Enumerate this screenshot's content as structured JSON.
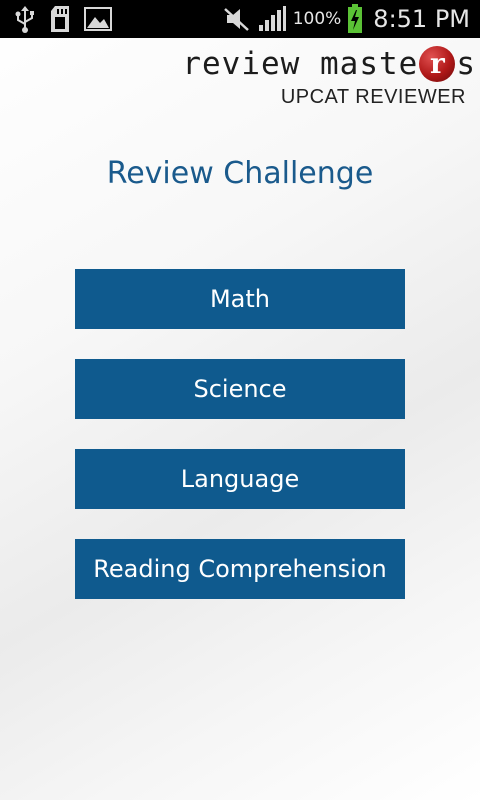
{
  "status_bar": {
    "battery_percent": "100%",
    "time": "8:51 PM",
    "icons": [
      "usb-icon",
      "sd-card-icon",
      "image-icon",
      "mute-icon",
      "signal-icon",
      "battery-charging-icon"
    ]
  },
  "header": {
    "logo_text_left": "review maste",
    "logo_badge": "r",
    "logo_text_right": "s",
    "subtitle": "UPCAT REVIEWER"
  },
  "main": {
    "title": "Review Challenge",
    "buttons": [
      {
        "label": "Math"
      },
      {
        "label": "Science"
      },
      {
        "label": "Language"
      },
      {
        "label": "Reading Comprehension"
      }
    ]
  },
  "colors": {
    "accent": "#0f5a8e",
    "title": "#1a5a8c",
    "logo_badge": "#b01818"
  }
}
